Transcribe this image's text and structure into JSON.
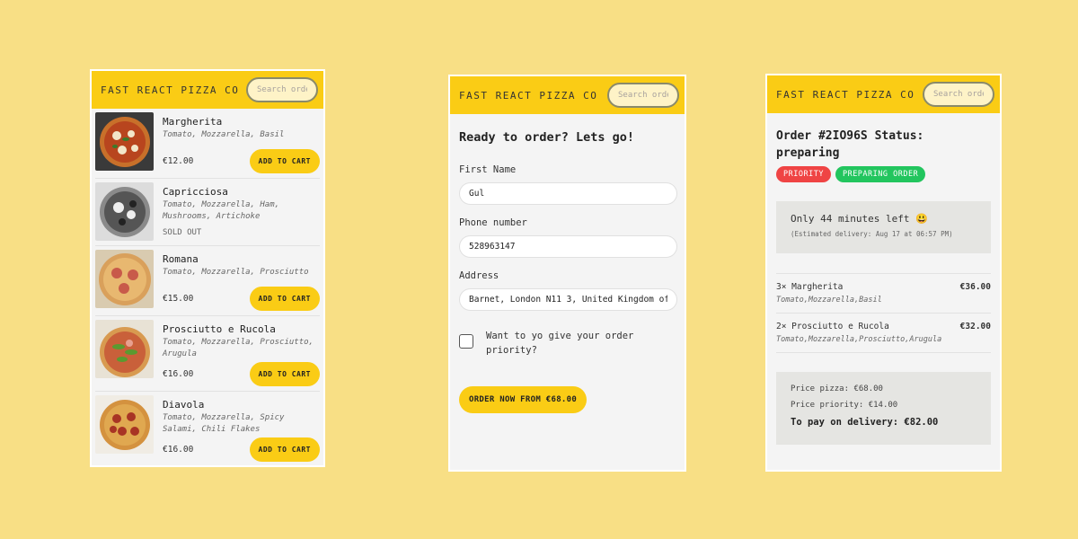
{
  "brand": "FAST REACT PIZZA CO",
  "search_placeholder": "Search order #",
  "menu": {
    "pizzas": [
      {
        "name": "Margherita",
        "ingredients": "Tomato, Mozzarella, Basil",
        "price": "€12.00",
        "sold_out": false,
        "button": "ADD TO CART"
      },
      {
        "name": "Capricciosa",
        "ingredients": "Tomato, Mozzarella, Ham, Mushrooms, Artichoke",
        "price": "",
        "sold_out": true,
        "sold_out_label": "SOLD OUT"
      },
      {
        "name": "Romana",
        "ingredients": "Tomato, Mozzarella, Prosciutto",
        "price": "€15.00",
        "sold_out": false,
        "button": "ADD TO CART"
      },
      {
        "name": "Prosciutto e Rucola",
        "ingredients": "Tomato, Mozzarella, Prosciutto, Arugula",
        "price": "€16.00",
        "sold_out": false,
        "button": "ADD TO CART"
      },
      {
        "name": "Diavola",
        "ingredients": "Tomato, Mozzarella, Spicy Salami, Chili Flakes",
        "price": "€16.00",
        "sold_out": false,
        "button": "ADD TO CART"
      }
    ]
  },
  "order_form": {
    "title": "Ready to order? Lets go!",
    "first_name_label": "First Name",
    "first_name_value": "Gul",
    "phone_label": "Phone number",
    "phone_value": "528963147",
    "address_label": "Address",
    "address_value": "Barnet, London N11 3, United Kingdom of",
    "priority_label": "Want to yo give your order priority?",
    "submit_label": "ORDER NOW FROM €68.00"
  },
  "order_status": {
    "title": "Order #2IO96S Status: preparing",
    "badge_priority": "PRIORITY",
    "badge_status": "PREPARING ORDER",
    "eta_main": "Only 44 minutes left 😃",
    "eta_sub": "(Estimated delivery: Aug 17 at 06:57 PM)",
    "items": [
      {
        "qty_name": "3× Margherita",
        "price": "€36.00",
        "ingredients": "Tomato,Mozzarella,Basil"
      },
      {
        "qty_name": "2× Prosciutto e Rucola",
        "price": "€32.00",
        "ingredients": "Tomato,Mozzarella,Prosciutto,Arugula"
      }
    ],
    "price_pizza": "Price pizza: €68.00",
    "price_priority": "Price priority: €14.00",
    "to_pay": "To pay on delivery: €82.00"
  },
  "colors": {
    "background": "#f8df85",
    "accent": "#facc15",
    "priority": "#ef4444",
    "preparing": "#22c55e"
  }
}
